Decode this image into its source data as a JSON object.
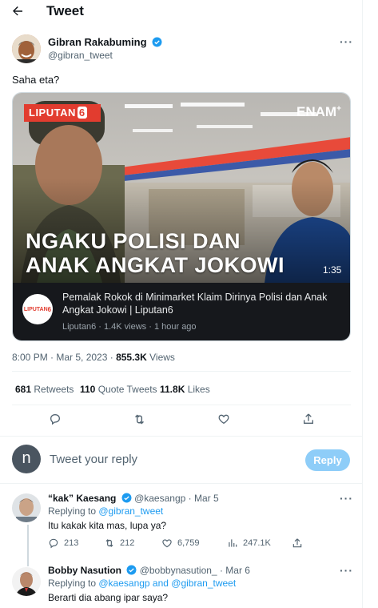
{
  "header": {
    "title": "Tweet"
  },
  "tweet": {
    "author_name": "Gibran Rakabuming",
    "author_handle": "@gibran_tweet",
    "text": "Saha eta?",
    "card": {
      "brand_left": "LIPUTAN",
      "brand_left_num": "6",
      "brand_right": "ENAM",
      "brand_right_sup": "+",
      "headline_line1": "NGAKU POLISI DAN",
      "headline_line2": "ANAK ANGKAT JOKOWI",
      "duration": "1:35",
      "logo_text": "LIPUTAN",
      "logo_num": "6",
      "title": "Pemalak Rokok di Minimarket Klaim Dirinya Polisi dan Anak Angkat Jokowi | Liputan6",
      "meta": "Liputan6 · 1.4K views · 1 hour ago"
    },
    "timestamp": "8:00 PM · Mar 5, 2023",
    "views_count": "855.3K",
    "views_label": "Views",
    "retweets_count": "681",
    "retweets_label": "Retweets",
    "quotes_count": "110",
    "quotes_label": "Quote Tweets",
    "likes_count": "11.8K",
    "likes_label": "Likes"
  },
  "composer": {
    "avatar_letter": "n",
    "placeholder": "Tweet your reply",
    "button_label": "Reply"
  },
  "replies": [
    {
      "name": "“kak” Kaesang",
      "handle_time": "@kaesangp · Mar 5",
      "replying_prefix": "Replying to ",
      "replying_to": "@gibran_tweet",
      "text": "Itu kakak kita mas, lupa ya?",
      "stats": {
        "replies": "213",
        "retweets": "212",
        "likes": "6,759",
        "views": "247.1K"
      }
    },
    {
      "name": "Bobby Nasution",
      "handle_time": "@bobbynasution_ · Mar 6",
      "replying_prefix": "Replying to ",
      "replying_to": "@kaesangp and @gibran_tweet",
      "text": "Berarti dia abang ipar saya?"
    }
  ],
  "colors": {
    "accent": "#1d9bf0",
    "reply_button": "#8ecdf8",
    "muted": "#536471",
    "brand_red": "#e23c2f"
  }
}
